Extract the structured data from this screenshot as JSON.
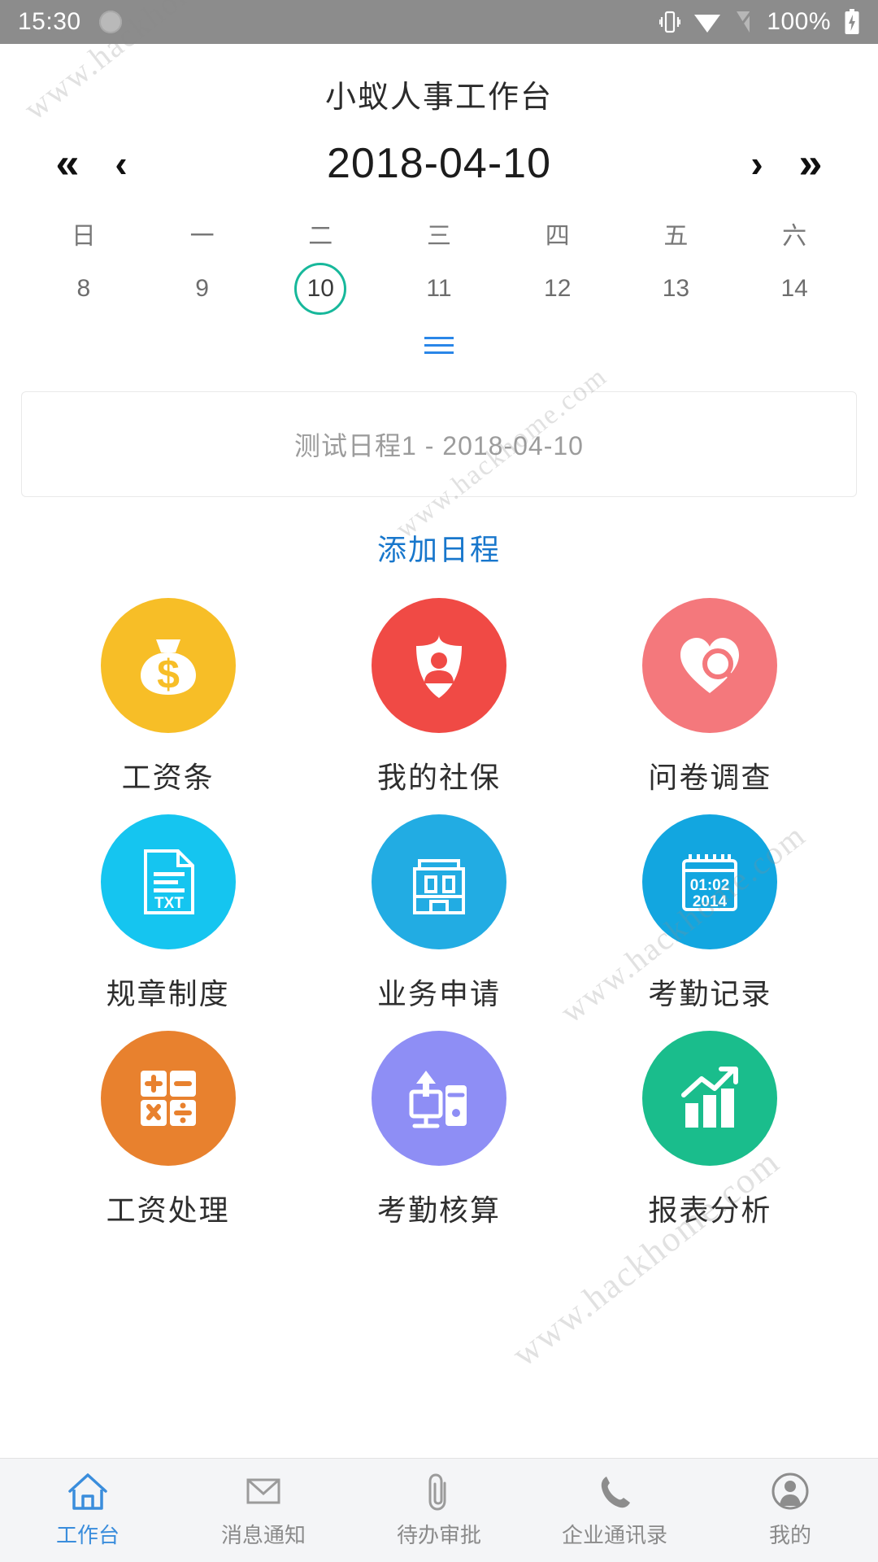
{
  "statusbar": {
    "time": "15:30",
    "battery_pct": "100%",
    "icons": [
      "vibrate-icon",
      "wifi-icon",
      "signal-icon",
      "battery-charging-icon"
    ]
  },
  "header": {
    "app_title": "小蚁人事工作台"
  },
  "calendar": {
    "current_date": "2018-04-10",
    "nav": {
      "first": "«",
      "prev": "‹",
      "next": "›",
      "last": "»"
    },
    "weekdays": [
      "日",
      "一",
      "二",
      "三",
      "四",
      "五",
      "六"
    ],
    "days": [
      {
        "num": "8",
        "selected": false
      },
      {
        "num": "9",
        "selected": false
      },
      {
        "num": "10",
        "selected": true
      },
      {
        "num": "11",
        "selected": false
      },
      {
        "num": "12",
        "selected": false
      },
      {
        "num": "13",
        "selected": false
      },
      {
        "num": "14",
        "selected": false
      }
    ],
    "selected_color": "#17b89b",
    "expand_icon": "hamburger-expand-icon",
    "expand_color": "#2a86e8"
  },
  "schedule": {
    "item_text": "测试日程1 - 2018-04-10",
    "add_label": "添加日程",
    "add_color": "#1877cc"
  },
  "apps": [
    {
      "label": "工资条",
      "icon": "money-bag-icon",
      "color": "#f7be27"
    },
    {
      "label": "我的社保",
      "icon": "shield-person-icon",
      "color": "#f04a45"
    },
    {
      "label": "问卷调查",
      "icon": "heart-search-icon",
      "color": "#f4787c"
    },
    {
      "label": "规章制度",
      "icon": "txt-document-icon",
      "color": "#15c5f0"
    },
    {
      "label": "业务申请",
      "icon": "building-icon",
      "color": "#22ace3"
    },
    {
      "label": "考勤记录",
      "icon": "calendar-clock-icon",
      "color": "#12a6e0",
      "icon_text_top": "01:02",
      "icon_text_bottom": "2014"
    },
    {
      "label": "工资处理",
      "icon": "calculator-icon",
      "color": "#e8812e"
    },
    {
      "label": "考勤核算",
      "icon": "upload-device-icon",
      "color": "#8e8ef5"
    },
    {
      "label": "报表分析",
      "icon": "bar-chart-growth-icon",
      "color": "#1abd8c"
    }
  ],
  "tabbar": {
    "active_color": "#3a8ddc",
    "items": [
      {
        "label": "工作台",
        "icon": "home-icon",
        "active": true
      },
      {
        "label": "消息通知",
        "icon": "envelope-icon",
        "active": false
      },
      {
        "label": "待办审批",
        "icon": "paperclip-icon",
        "active": false
      },
      {
        "label": "企业通讯录",
        "icon": "phone-icon",
        "active": false
      },
      {
        "label": "我的",
        "icon": "person-icon",
        "active": false
      }
    ]
  },
  "watermarks": [
    "www.hackhome.com",
    "www.hackhome.com",
    "www.hackhome.com"
  ]
}
